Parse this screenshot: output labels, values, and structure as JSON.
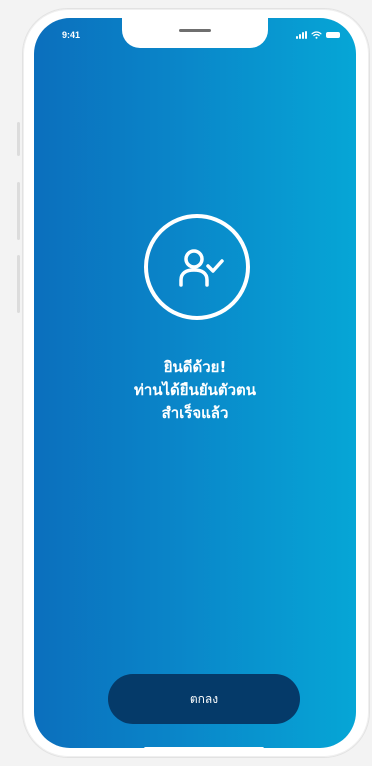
{
  "status_bar": {
    "time": "9:41"
  },
  "icons": {
    "main": "user-check-icon",
    "signal": "signal-icon",
    "wifi": "wifi-icon",
    "battery": "battery-icon"
  },
  "success": {
    "line1": "ยินดีด้วย!",
    "line2": "ท่านได้ยืนยันตัวตน",
    "line3": "สำเร็จแล้ว"
  },
  "actions": {
    "ok_label": "ตกลง"
  },
  "colors": {
    "gradient_start": "#0b6fbd",
    "gradient_end": "#06a6d6",
    "button": "#053a69",
    "text": "#ffffff"
  }
}
